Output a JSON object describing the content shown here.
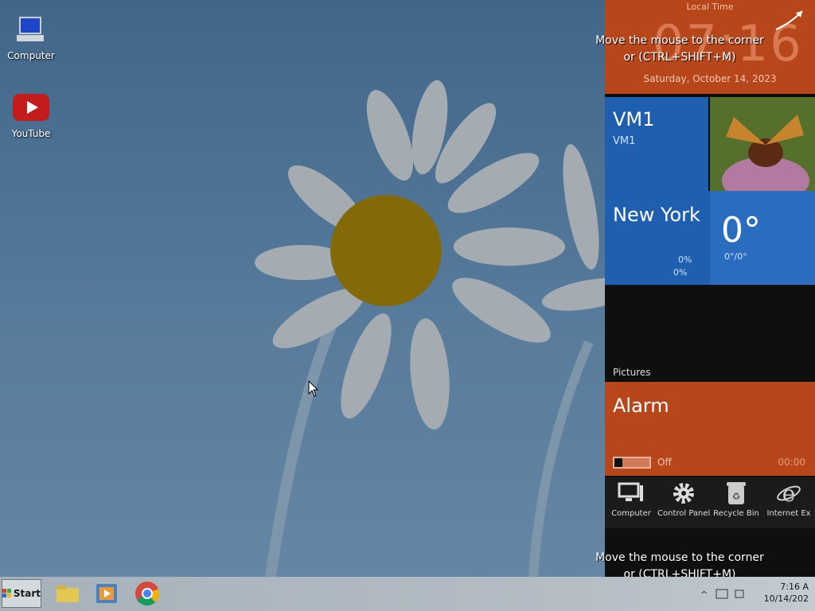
{
  "desktop": {
    "icons": [
      {
        "label": "Computer"
      },
      {
        "label": "YouTube"
      }
    ]
  },
  "taskbar": {
    "start_label": "Start",
    "clock_time": "7:16 A",
    "clock_date": "10/14/202"
  },
  "panel": {
    "clock": {
      "header": "Local Time",
      "time": "07:16",
      "date": "Saturday, October 14, 2023"
    },
    "vm": {
      "name": "VM1",
      "sub": "VM1"
    },
    "weather": {
      "city": "New York",
      "temp": "0°",
      "range": "0°/0°",
      "precip": "0%",
      "humidity": "0%"
    },
    "pictures_label": "Pictures",
    "alarm": {
      "title": "Alarm",
      "state": "Off",
      "time": "00:00"
    },
    "shortcuts": [
      {
        "label": "Computer"
      },
      {
        "label": "Control Panel"
      },
      {
        "label": "Recycle Bin"
      },
      {
        "label": "Internet Ex"
      }
    ]
  },
  "hints": {
    "top_line1": "Move the mouse to the corner",
    "top_line2": "or (CTRL+SHIFT+M)",
    "bottom_line1": "Move the mouse to the corner",
    "bottom_line2": "or (CTRL+SHIFT+M)"
  },
  "colors": {
    "tile_orange": "#b8461b",
    "tile_blue": "#1f5fb0"
  }
}
